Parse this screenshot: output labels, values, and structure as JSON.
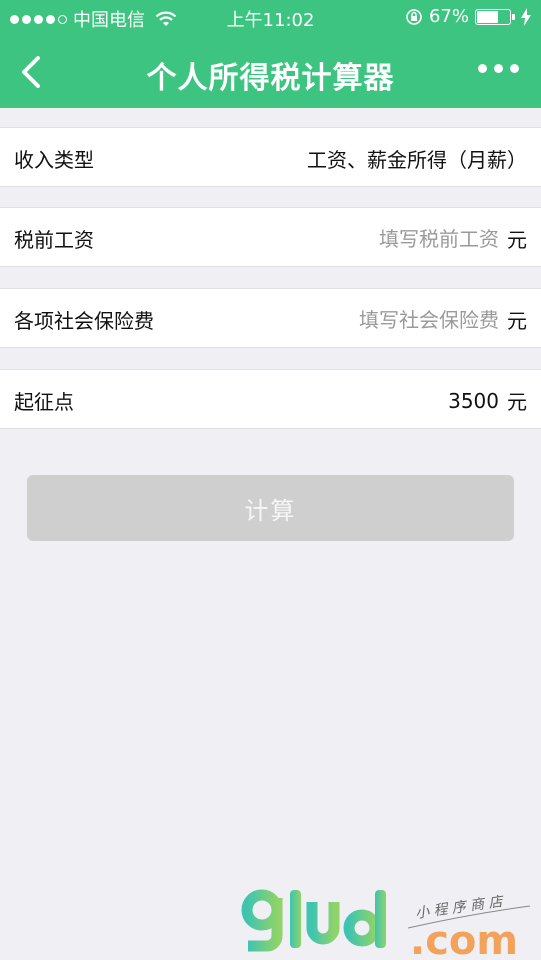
{
  "status_bar": {
    "carrier": "中国电信",
    "time": "上午11:02",
    "battery_percent": "67%",
    "battery_level": 0.67,
    "signal_bars_filled": 4,
    "signal_bars_total": 5
  },
  "nav": {
    "title": "个人所得税计算器",
    "back_icon": "chevron-left-icon",
    "more_icon": "more-dots-icon"
  },
  "form": {
    "income_type": {
      "label": "收入类型",
      "value": "工资、薪金所得（月薪）"
    },
    "pretax_salary": {
      "label": "税前工资",
      "placeholder": "填写税前工资",
      "unit": "元"
    },
    "social_insurance": {
      "label": "各项社会保险费",
      "placeholder": "填写社会保险费",
      "unit": "元"
    },
    "threshold": {
      "label": "起征点",
      "value": "3500",
      "unit": "元"
    }
  },
  "calculate_button": {
    "label": "计算"
  },
  "watermark": {
    "brand": "glud",
    "domain": ".com",
    "tagline": "小程序商店"
  },
  "colors": {
    "accent": "#3cc480",
    "button_disabled": "#cfcfcf",
    "background": "#efeff4"
  }
}
